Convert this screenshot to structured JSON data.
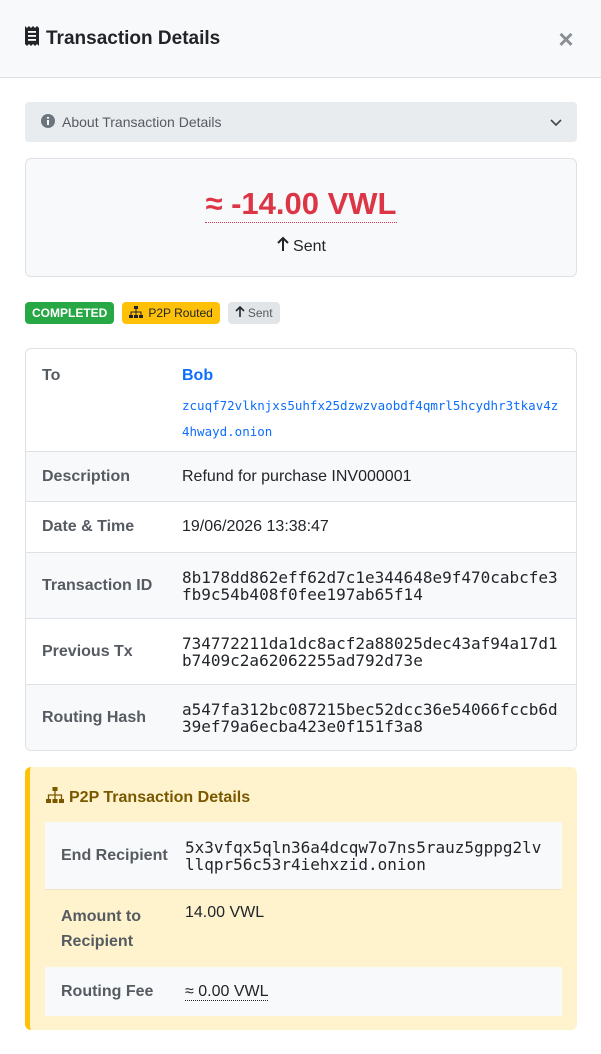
{
  "header": {
    "title": "Transaction Details",
    "close_glyph": "×"
  },
  "accordion": {
    "label": "About Transaction Details",
    "icon": "info-icon"
  },
  "amount": {
    "value": "≈ -14.00 VWL",
    "direction": "Sent",
    "color": "#dc3545"
  },
  "badges": {
    "status": "COMPLETED",
    "p2p": "P2P Routed",
    "direction": "Sent"
  },
  "details": {
    "to_label": "To",
    "to_name": "Bob",
    "to_address": "zcuqf72vlknjxs5uhfx25dzwzvaobdf4qmrl5hcydhr3tkav4z4hwayd.onion",
    "description_label": "Description",
    "description": "Refund for purchase INV000001",
    "datetime_label": "Date & Time",
    "datetime": "19/06/2026 13:38:47",
    "txid_label": "Transaction ID",
    "txid": "8b178dd862eff62d7c1e344648e9f470cabcfe3fb9c54b408f0fee197ab65f14",
    "prev_label": "Previous Tx",
    "prev": "734772211da1dc8acf2a88025dec43af94a17d1b7409c2a62062255ad792d73e",
    "routing_label": "Routing Hash",
    "routing": "a547fa312bc087215bec52dcc36e54066fccb6d39ef79a6ecba423e0f151f3a8"
  },
  "p2p": {
    "title": "P2P Transaction Details",
    "end_label": "End Recipient",
    "end_value": "5x3vfqx5qln36a4dcqw7o7ns5rauz5gppg2lvllqpr56c53r4iehxzid.onion",
    "amount_label": "Amount to Recipient",
    "amount_value": "14.00 VWL",
    "fee_label": "Routing Fee",
    "fee_value": "≈ 0.00 VWL"
  },
  "colors": {
    "accent_link": "#0d6efd",
    "success": "#28a745",
    "warning": "#ffc107",
    "danger": "#dc3545"
  }
}
